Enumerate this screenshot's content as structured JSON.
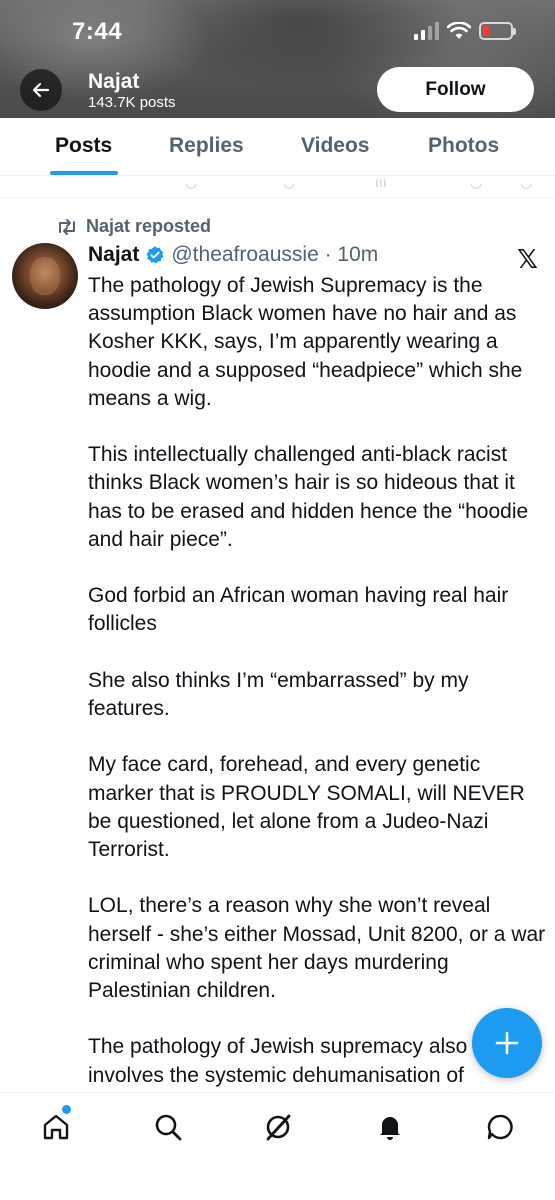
{
  "status_bar": {
    "time": "7:44"
  },
  "profile": {
    "name": "Najat",
    "post_count": "143.7K posts",
    "follow_label": "Follow"
  },
  "tabs": [
    {
      "label": "Posts",
      "active": true
    },
    {
      "label": "Replies",
      "active": false
    },
    {
      "label": "Videos",
      "active": false
    },
    {
      "label": "Photos",
      "active": false
    }
  ],
  "post": {
    "repost_text": "Najat reposted",
    "author_name": "Najat",
    "handle_time": "@theafroaussie · 10m",
    "x_logo": "𝕏",
    "paragraphs": [
      "The pathology of Jewish Supremacy is the assumption Black women have no hair and as Kosher KKK, says, I’m apparently wearing a hoodie and a supposed “headpiece” which she means a wig.",
      "This intellectually challenged anti-black racist thinks Black women’s hair is so hideous that it has to be erased and hidden hence the “hoodie and hair piece”.",
      "God forbid an African woman having real hair follicles",
      "She also thinks I’m “embarrassed” by my features.",
      "My face card, forehead, and every genetic marker that is PROUDLY SOMALI, will NEVER be questioned, let alone from a Judeo-Nazi Terrorist.",
      "LOL, there’s a reason why she won’t reveal herself - she’s either Mossad, Unit 8200, or a war criminal who spent her days murdering Palestinian children.",
      "The pathology of Jewish supremacy also involves the systemic dehumanisation of"
    ]
  },
  "colors": {
    "accent": "#1d9bf0",
    "text": "#0f1419",
    "secondary": "#536471"
  },
  "icons": {
    "back": "arrow-left-icon",
    "repost": "repost-icon",
    "verified": "verified-badge-icon",
    "compose": "plus-icon",
    "nav": [
      "home-icon",
      "search-icon",
      "grok-icon",
      "notifications-bell-icon",
      "messages-icon"
    ]
  }
}
